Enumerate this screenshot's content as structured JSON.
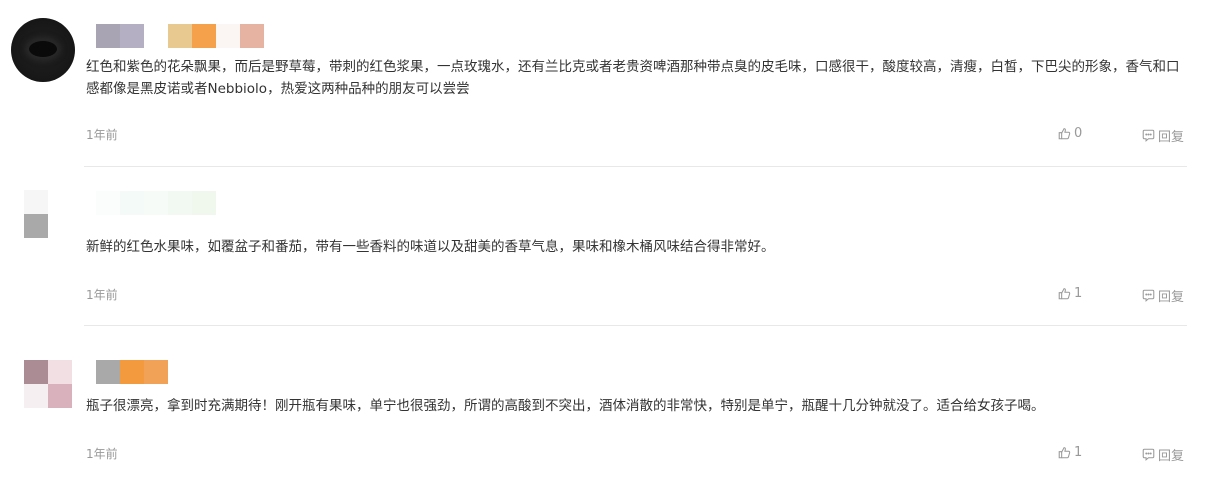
{
  "comments": [
    {
      "text": "红色和紫色的花朵飘果，而后是野草莓，带刺的红色浆果，一点玫瑰水，还有兰比克或者老贵资啤酒那种带点臭的皮毛味，口感很干，酸度较高，清瘦，白皙，下巴尖的形象，香气和口感都像是黑皮诺或者Nebbiolo，热爱这两种品种的朋友可以尝尝",
      "time": "1年前",
      "likes": "0",
      "reply_label": "回复"
    },
    {
      "text": "新鲜的红色水果味，如覆盆子和番茄，带有一些香料的味道以及甜美的香草气息，果味和橡木桶风味结合得非常好。",
      "time": "1年前",
      "likes": "1",
      "reply_label": "回复"
    },
    {
      "text": "瓶子很漂亮，拿到时充满期待！刚开瓶有果味，单宁也很强劲，所谓的高酸到不突出，酒体消散的非常快，特别是单宁，瓶醒十几分钟就没了。适合给女孩子喝。",
      "time": "1年前",
      "likes": "1",
      "reply_label": "回复"
    }
  ]
}
